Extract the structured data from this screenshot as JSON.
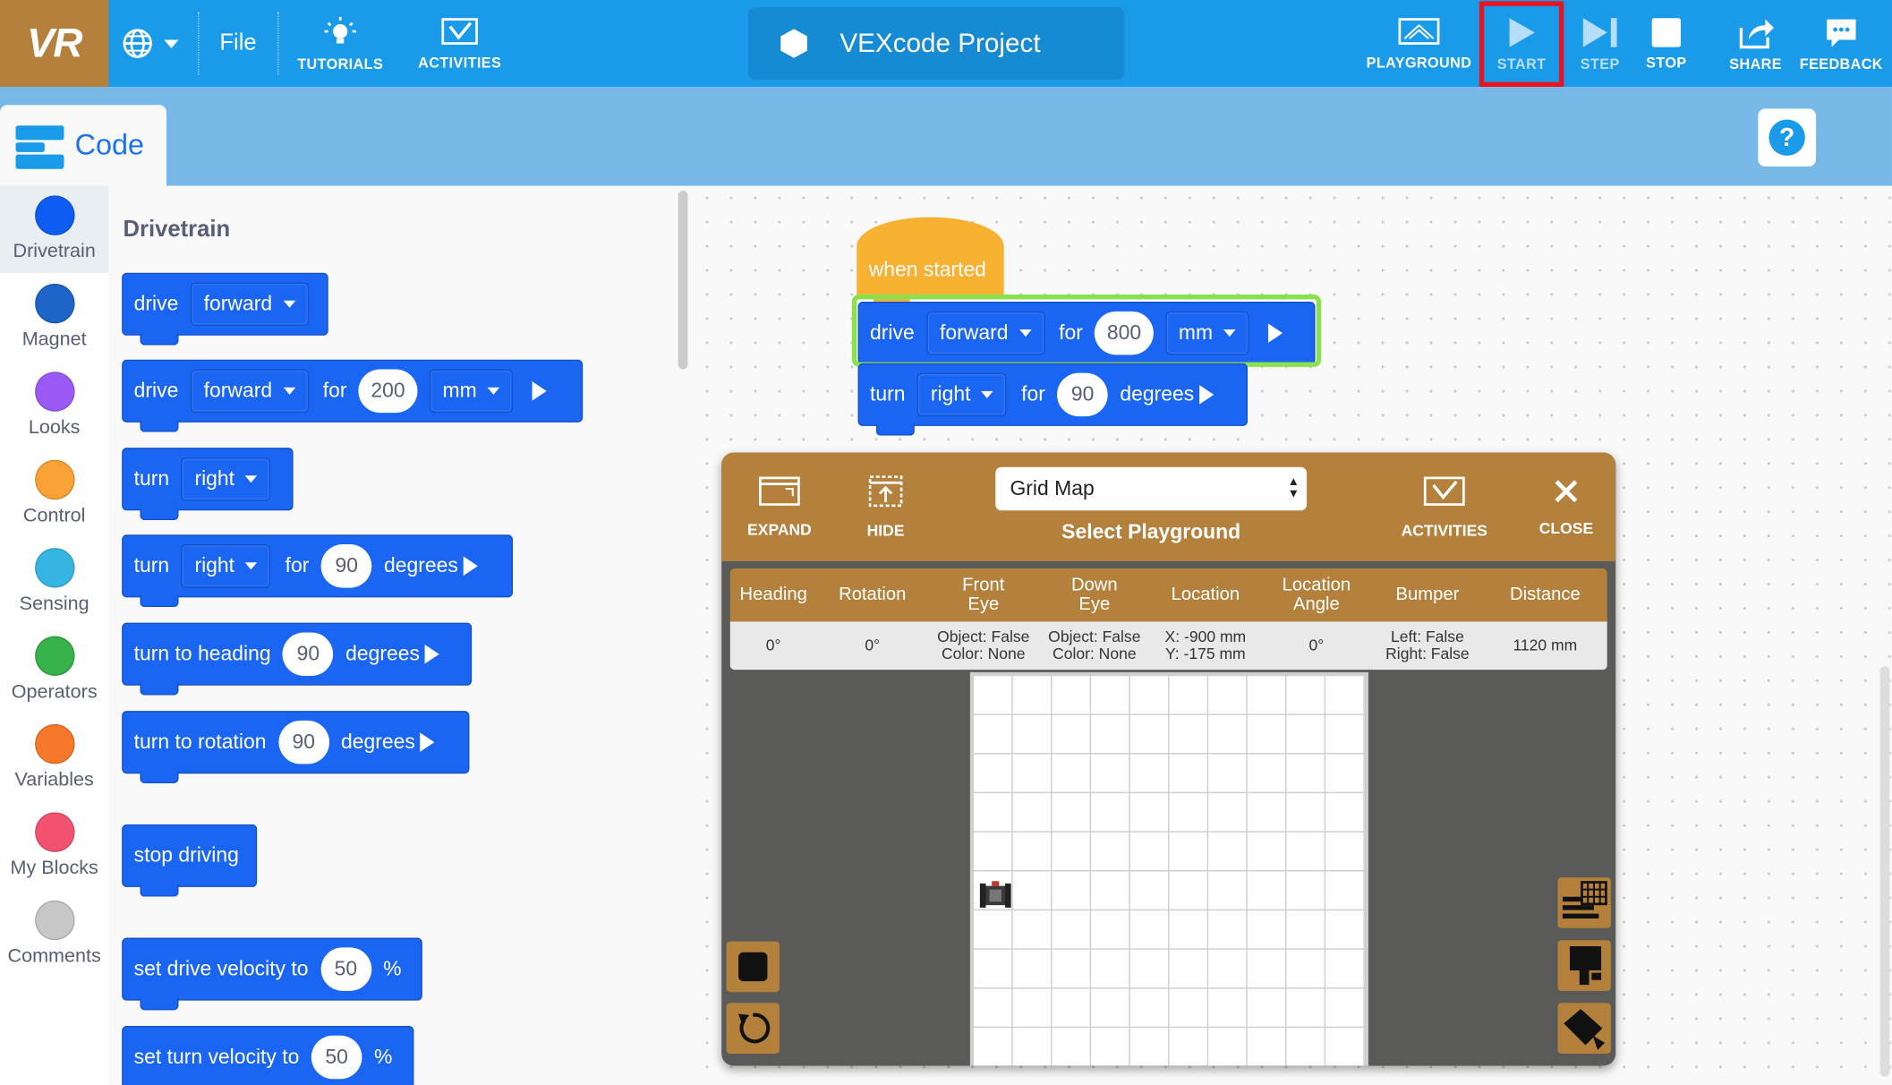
{
  "topbar": {
    "logo": "VR",
    "file": "File",
    "tutorials": "TUTORIALS",
    "activities": "ACTIVITIES",
    "project_name": "VEXcode Project",
    "playground": "PLAYGROUND",
    "start": "START",
    "step": "STEP",
    "stop": "STOP",
    "share": "SHARE",
    "feedback": "FEEDBACK",
    "accent": "#1a9bea",
    "highlight": "#e8141f"
  },
  "code_tab": "Code",
  "categories": [
    {
      "label": "Drivetrain",
      "color": "#0f5cf2"
    },
    {
      "label": "Magnet",
      "color": "#1f64c8"
    },
    {
      "label": "Looks",
      "color": "#9b59f5"
    },
    {
      "label": "Control",
      "color": "#f8a134"
    },
    {
      "label": "Sensing",
      "color": "#37b5e2"
    },
    {
      "label": "Operators",
      "color": "#37b24a"
    },
    {
      "label": "Variables",
      "color": "#f7782a"
    },
    {
      "label": "My Blocks",
      "color": "#f2526f"
    },
    {
      "label": "Comments",
      "color": "#c7c7c7"
    }
  ],
  "flyout": {
    "title": "Drivetrain",
    "b1": {
      "cmd": "drive",
      "dir": "forward"
    },
    "b2": {
      "cmd": "drive",
      "dir": "forward",
      "for": "for",
      "value": "200",
      "unit": "mm"
    },
    "b3": {
      "cmd": "turn",
      "dir": "right"
    },
    "b4": {
      "cmd": "turn",
      "dir": "right",
      "for": "for",
      "value": "90",
      "unit": "degrees"
    },
    "b5": {
      "text": "turn to heading",
      "value": "90",
      "unit": "degrees"
    },
    "b6": {
      "text": "turn to rotation",
      "value": "90",
      "unit": "degrees"
    },
    "b7": {
      "text": "stop driving"
    },
    "b8": {
      "text": "set drive velocity to",
      "value": "50",
      "unit": "%"
    },
    "b9": {
      "text": "set turn velocity to",
      "value": "50",
      "unit": "%"
    }
  },
  "workspace": {
    "hat": "when started",
    "s1": {
      "cmd": "drive",
      "dir": "forward",
      "for": "for",
      "value": "800",
      "unit": "mm"
    },
    "s2": {
      "cmd": "turn",
      "dir": "right",
      "for": "for",
      "value": "90",
      "unit": "degrees"
    }
  },
  "playground": {
    "expand": "EXPAND",
    "hide": "HIDE",
    "select_value": "Grid Map",
    "select_label": "Select Playground",
    "activities": "ACTIVITIES",
    "close": "CLOSE",
    "headers": [
      "Heading",
      "Rotation",
      "Front\nEye",
      "Down\nEye",
      "Location",
      "Location\nAngle",
      "Bumper",
      "Distance"
    ],
    "row": [
      "0°",
      "0°",
      "Object: False\nColor: None",
      "Object: False\nColor: None",
      "X: -900 mm\nY: -175 mm",
      "0°",
      "Left: False\nRight: False",
      "1120 mm"
    ]
  }
}
